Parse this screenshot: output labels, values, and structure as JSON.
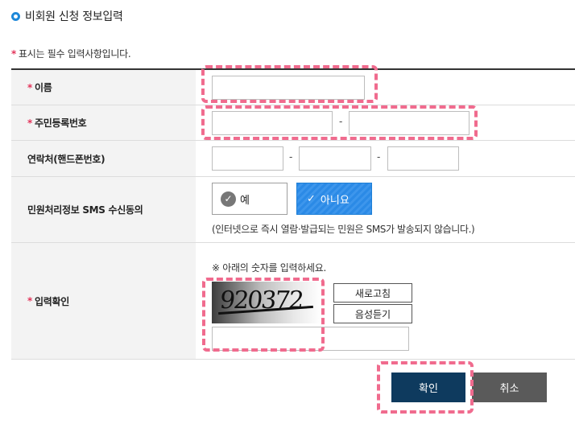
{
  "page": {
    "title": "비회원 신청 정보입력",
    "required_star": "*",
    "required_note": "표시는 필수 입력사항입니다."
  },
  "form": {
    "name_label": "이름",
    "rrn_label": "주민등록번호",
    "rrn_sep": "-",
    "phone_label": "연락처(핸드폰번호)",
    "phone_sep": "-",
    "sms_label": "민원처리정보 SMS 수신동의",
    "sms_yes": "예",
    "sms_no": "아니요",
    "sms_selected": "아니요",
    "sms_note": "(인터넷으로 즉시 열람·발급되는 민원은 SMS가 발송되지 않습니다.)",
    "captcha_label": "입력확인",
    "captcha_note": "※ 아래의 숫자를 입력하세요.",
    "captcha_text": "920372",
    "refresh_label": "새로고침",
    "audio_label": "음성듣기"
  },
  "actions": {
    "ok_label": "확인",
    "cancel_label": "취소"
  },
  "colors": {
    "accent": "#1e88d9",
    "required": "#e3345a",
    "highlight": "#f06b8e",
    "ok_bg": "#0e3a5e",
    "cancel_bg": "#5a5a5a",
    "selected_radio": "#2b8ae6"
  }
}
